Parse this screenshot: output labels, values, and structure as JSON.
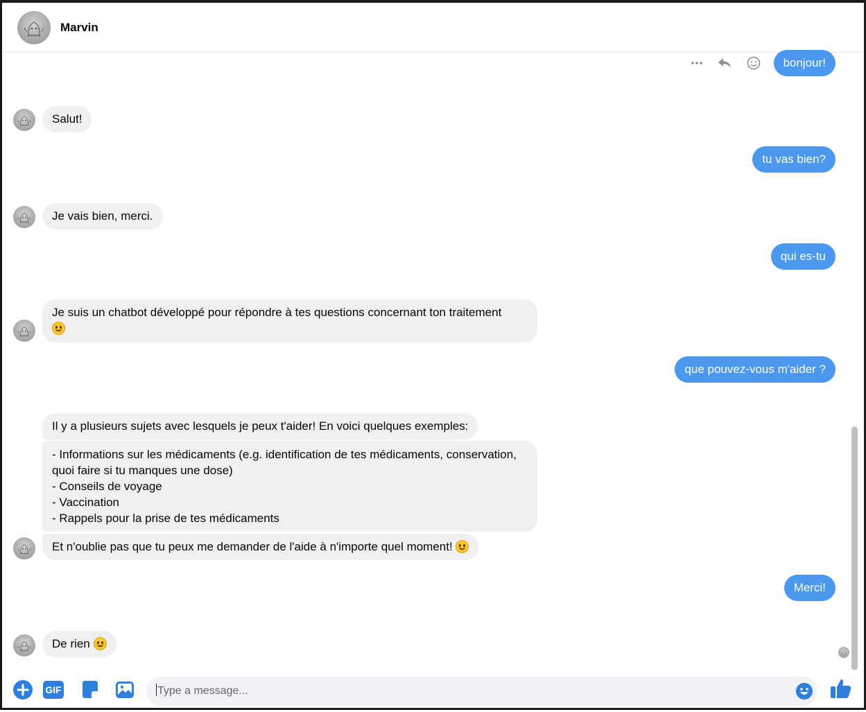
{
  "header": {
    "contact_name": "Marvin",
    "avatar_icon": "profile-avatar"
  },
  "actions": {
    "more_icon": "more-horizontal-icon",
    "reply_icon": "reply-icon",
    "react_icon": "smiley-outline-icon"
  },
  "messages": [
    {
      "from": "user",
      "text": "bonjour!"
    },
    {
      "from": "bot",
      "text": "Salut!"
    },
    {
      "from": "user",
      "text": "tu vas bien?"
    },
    {
      "from": "bot",
      "text": "Je vais bien, merci."
    },
    {
      "from": "user",
      "text": "qui es-tu"
    },
    {
      "from": "bot",
      "text": "Je suis un chatbot développé pour répondre à tes questions concernant ton traitement",
      "emoji": "smiling-face-emoji"
    },
    {
      "from": "user",
      "text": "que pouvez-vous m'aider ?"
    },
    {
      "from": "bot",
      "text": "Il y a plusieurs sujets avec lesquels je peux t'aider! En voici quelques exemples:"
    },
    {
      "from": "bot",
      "text": "- Informations sur les médicaments (e.g. identification de tes médicaments, conservation,\nquoi faire si tu manques une dose)\n- Conseils de voyage\n- Vaccination\n- Rappels pour la prise de tes médicaments"
    },
    {
      "from": "bot",
      "text": "Et n'oublie pas que tu peux me demander de l'aide à n'importe quel moment!",
      "emoji": "slightly-smiling-face-emoji"
    },
    {
      "from": "user",
      "text": "Merci!"
    },
    {
      "from": "bot",
      "text": "De rien",
      "emoji": "slightly-smiling-face-emoji"
    }
  ],
  "composer": {
    "placeholder": "Type a message...",
    "tools": [
      "add-icon",
      "gif-icon",
      "sticker-icon",
      "image-icon"
    ],
    "gif_label": "GIF",
    "emoji_icon": "emoji-icon",
    "send_icon": "thumbs-up-icon"
  },
  "colors": {
    "accent": "#4a98f0",
    "incoming_bubble": "#f0f0f0",
    "composer_bg": "#f0f2f5"
  }
}
